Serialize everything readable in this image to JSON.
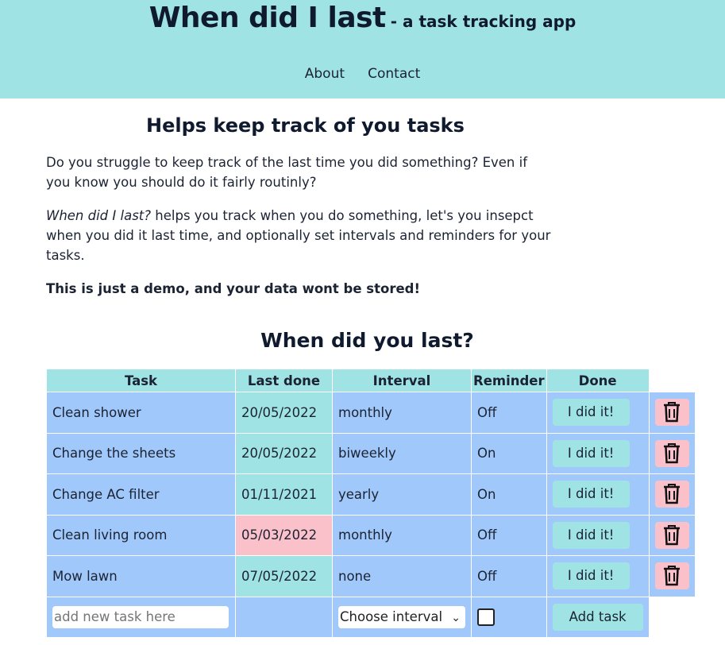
{
  "header": {
    "title": "When did I last",
    "subtitle": "- a task tracking app",
    "nav": [
      "About",
      "Contact"
    ]
  },
  "intro": {
    "heading": "Helps keep track of you tasks",
    "para1": "Do you struggle to keep track of the last time you did something? Even if you know you should do it fairly routinly?",
    "para2_em": "When did I last?",
    "para2_rest": " helps you track when you do something, let's you insepct when you did it last time, and optionally set intervals and reminders for your tasks.",
    "notice": "This is just a demo, and your data wont be stored!"
  },
  "table": {
    "heading": "When did you last?",
    "columns": [
      "Task",
      "Last done",
      "Interval",
      "Reminder",
      "Done"
    ],
    "rows": [
      {
        "task": "Clean shower",
        "last_done": "20/05/2022",
        "interval": "monthly",
        "reminder": "Off",
        "action": "I did it!"
      },
      {
        "task": "Change the sheets",
        "last_done": "20/05/2022",
        "interval": "biweekly",
        "reminder": "On",
        "action": "I did it!"
      },
      {
        "task": "Change AC filter",
        "last_done": "01/11/2021",
        "interval": "yearly",
        "reminder": "On",
        "action": "I did it!"
      },
      {
        "task": "Clean living room",
        "last_done": "05/03/2022",
        "interval": "monthly",
        "reminder": "Off",
        "action": "I did it!"
      },
      {
        "task": "Mow lawn",
        "last_done": "07/05/2022",
        "interval": "none",
        "reminder": "Off",
        "action": "I did it!"
      }
    ],
    "new_task_placeholder": "add new task here",
    "interval_select_value": "Choose interval",
    "add_button": "Add task"
  },
  "colors": {
    "accent": "#a0e3e5",
    "row_bg": "#a0c8fa",
    "overdue": "#fbc1cb"
  },
  "icons": {
    "delete": "trash-icon",
    "select": "chevron-down-icon"
  }
}
